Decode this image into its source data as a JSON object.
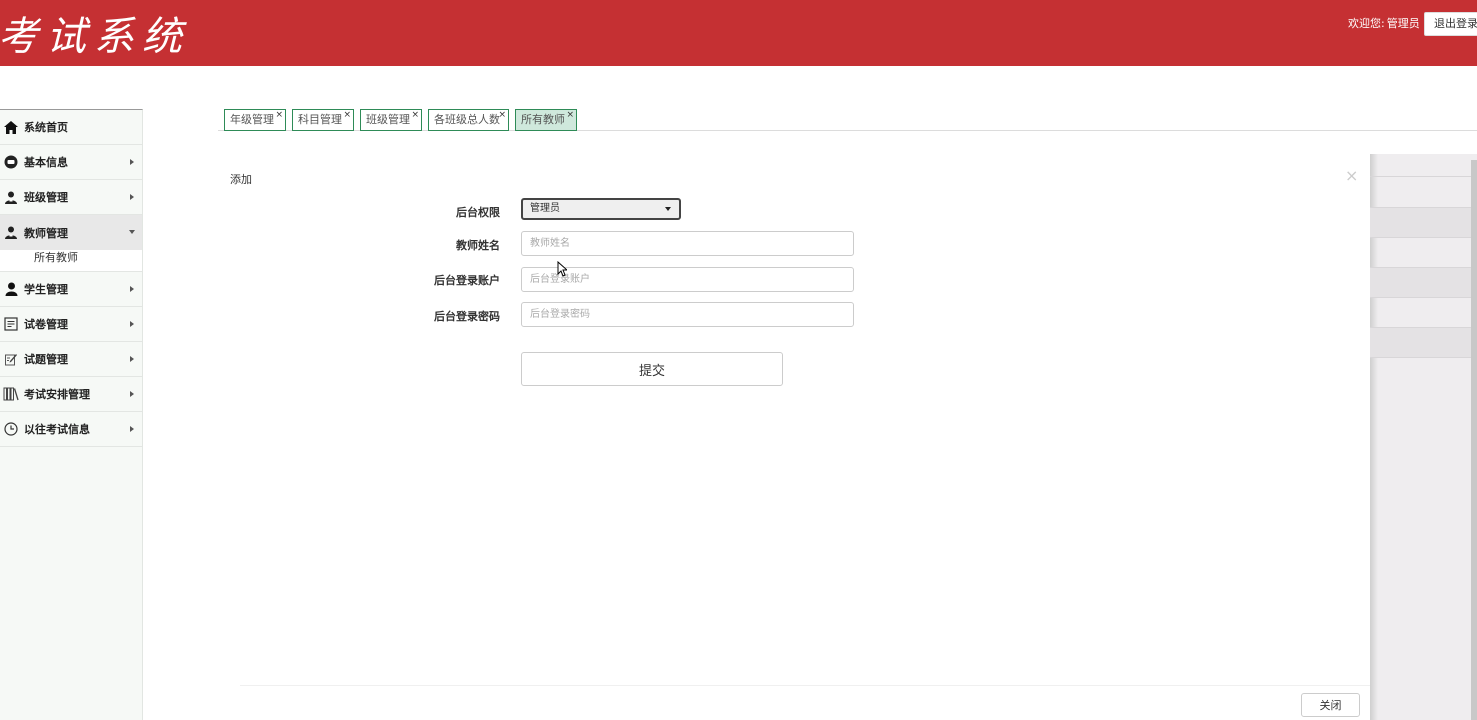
{
  "header": {
    "logo": "考试系统",
    "welcome_prefix": "欢迎您:",
    "username": "管理员",
    "logout_label": "退出登录"
  },
  "sidebar": {
    "items": [
      {
        "label": "系统首页",
        "icon": "home-icon",
        "has_arrow": false
      },
      {
        "label": "基本信息",
        "icon": "info-circle-icon",
        "has_arrow": true
      },
      {
        "label": "班级管理",
        "icon": "user-group-icon",
        "has_arrow": true
      },
      {
        "label": "教师管理",
        "icon": "user-group-icon",
        "has_arrow": true,
        "expanded": true,
        "children": [
          {
            "label": "所有教师"
          }
        ]
      },
      {
        "label": "学生管理",
        "icon": "user-icon",
        "has_arrow": true
      },
      {
        "label": "试卷管理",
        "icon": "document-icon",
        "has_arrow": true
      },
      {
        "label": "试题管理",
        "icon": "edit-icon",
        "has_arrow": true
      },
      {
        "label": "考试安排管理",
        "icon": "books-icon",
        "has_arrow": true
      },
      {
        "label": "以往考试信息",
        "icon": "clock-icon",
        "has_arrow": true
      }
    ]
  },
  "tabs": [
    {
      "label": "年级管理",
      "close": "×"
    },
    {
      "label": "科目管理",
      "close": "×"
    },
    {
      "label": "班级管理",
      "close": "×"
    },
    {
      "label": "各班级总人数",
      "close": "×"
    },
    {
      "label": "所有教师",
      "close": "×",
      "active": true
    }
  ],
  "modal": {
    "title": "添加",
    "close_glyph": "×",
    "fields": {
      "role": {
        "label": "后台权限",
        "value": "管理员"
      },
      "name": {
        "label": "教师姓名",
        "placeholder": "教师姓名"
      },
      "account": {
        "label": "后台登录账户",
        "placeholder": "后台登录账户"
      },
      "password": {
        "label": "后台登录密码",
        "placeholder": "后台登录密码"
      }
    },
    "submit_label": "提交",
    "footer_close_label": "关闭"
  },
  "colors": {
    "header_bg": "#c53033",
    "tab_border": "#2e8b57",
    "tab_active_bg": "#cfe8dc"
  }
}
